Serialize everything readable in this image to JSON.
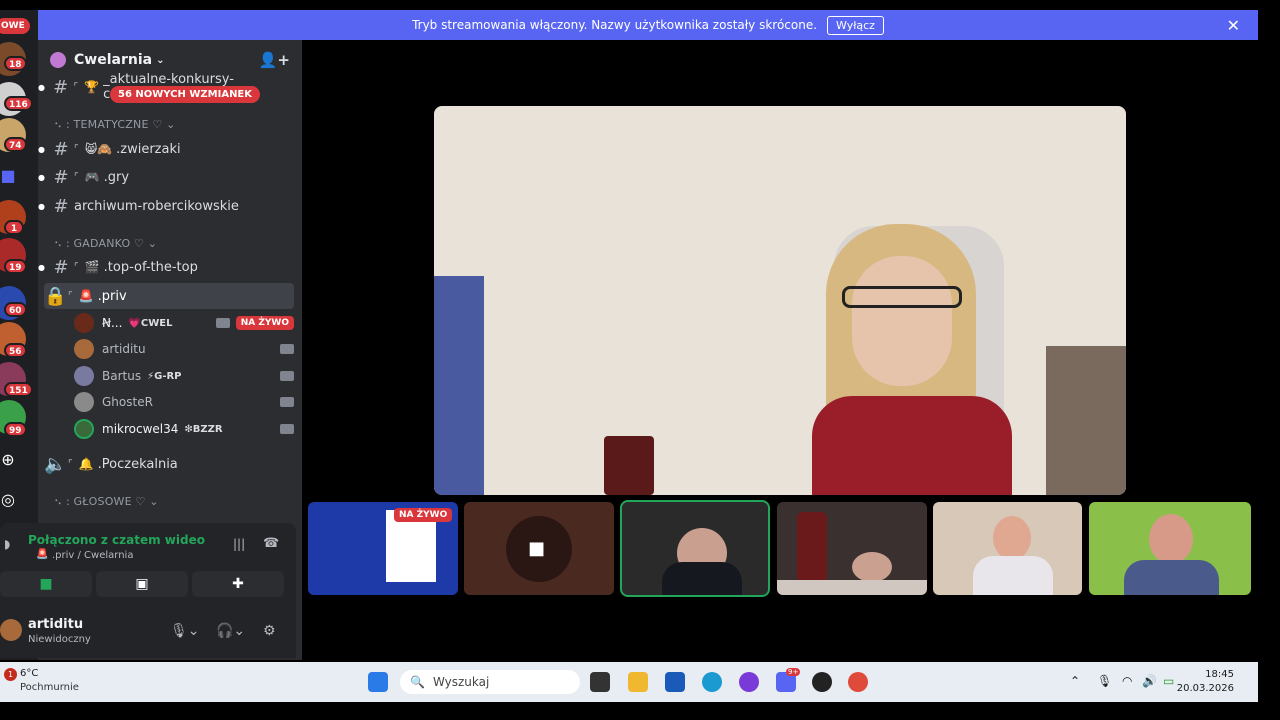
{
  "rail": {
    "nowe": "OWE",
    "badges": [
      "18",
      "116",
      "74",
      "1",
      "19",
      "60",
      "56",
      "151",
      "99"
    ]
  },
  "server": {
    "name": "Cwelarnia"
  },
  "channels": [
    {
      "name": "_aktualne-konkursy-csgoskins",
      "emoji": "🏆",
      "prefix": "⌜"
    },
    {
      "name": ".zwierzaki",
      "emoji": "😸🙈",
      "prefix": "⌜"
    },
    {
      "name": ".gry",
      "emoji": "🎮",
      "prefix": "⌜"
    },
    {
      "name": "archiwum-robercikowskie",
      "emoji": "",
      "prefix": ""
    },
    {
      "name": ".top-of-the-top",
      "emoji": "🎬",
      "prefix": "⌜"
    },
    {
      "name": ".priv",
      "emoji": "🚨",
      "prefix": "⌜"
    },
    {
      "name": ".Poczekalnia",
      "emoji": "🔔",
      "prefix": "⌜"
    }
  ],
  "mention_pill": "56 NOWYCH WZMIANEK",
  "categories": {
    "tematyczne": "⠢ : TEMATYCZNE ♡ ⌄",
    "gadanko": "⠢ : GADANKO ♡ ⌄",
    "glosowe": "⠢ : GŁOSOWE ♡ ⌄"
  },
  "voice_users": [
    {
      "name": "Ꞥ...",
      "tag": "💗CWEL",
      "live": "NA ŻYWO"
    },
    {
      "name": "artiditu",
      "tag": ""
    },
    {
      "name": "Bartus",
      "tag": "⚡G-RP"
    },
    {
      "name": "GhosteR",
      "tag": ""
    },
    {
      "name": "mikrocwel34",
      "tag": "❇BZZR"
    }
  ],
  "voice_panel": {
    "status": "Połączono z czatem wideo",
    "location": ".priv / Cwelarnia",
    "username": "artiditu",
    "presence": "Niewidoczny"
  },
  "banner": {
    "text": "Tryb streamowania włączony. Nazwy użytkownika zostały skrócone.",
    "button": "Wyłącz",
    "close": "✕"
  },
  "tiles": [
    {
      "live": "NA ŻYWO"
    }
  ],
  "taskbar": {
    "weather_badge": "1",
    "weather_temp": "6°C",
    "weather_desc": "Pochmurnie",
    "search_placeholder": "Wyszukaj",
    "time": "18:45",
    "date": "20.03.2026",
    "discord_badge": "9+"
  },
  "colors": {
    "accent": "#5865f2",
    "danger": "#da373c",
    "online": "#23a55a"
  }
}
